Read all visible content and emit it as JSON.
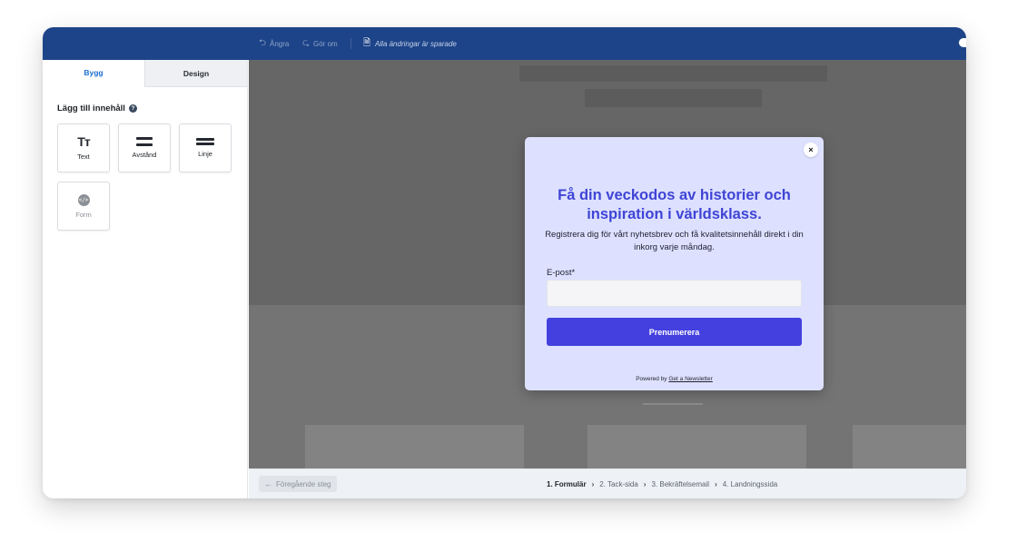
{
  "toolbar": {
    "undo_label": "Ångra",
    "undo_icon": "undo-arrow-icon",
    "redo_label": "Gör om",
    "redo_icon": "redo-arrow-icon",
    "saved_status": "Alla ändringar är sparade",
    "saved_icon": "document-check-icon",
    "preview_icon": "eye-icon"
  },
  "sidebar": {
    "tabs": [
      {
        "label": "Bygg",
        "active": true
      },
      {
        "label": "Design",
        "active": false
      }
    ],
    "section_title": "Lägg till innehåll",
    "help_icon": "?",
    "blocks": [
      {
        "label": "Text",
        "icon": "Tт"
      },
      {
        "label": "Avstånd",
        "icon": "spacer-icon"
      },
      {
        "label": "Linje",
        "icon": "divider-line-icon"
      },
      {
        "label": "Form",
        "icon": "</>"
      }
    ]
  },
  "popup": {
    "close_icon": "×",
    "heading": "Få din veckodos av historier och inspiration i världsklass.",
    "description": "Registrera dig för vårt nyhetsbrev och få kvalitetsinnehåll direkt i din inkorg varje måndag.",
    "email_label": "E-post*",
    "email_value": "",
    "email_placeholder": "",
    "submit_label": "Prenumerera",
    "powered_prefix": "Powered by",
    "powered_link": "Get a Newsletter",
    "accent_color": "#4340df",
    "background_color": "#dde1ff"
  },
  "footer": {
    "prev_label": "Föregående steg",
    "prev_icon": "←",
    "steps": [
      {
        "label": "1. Formulär",
        "active": true
      },
      {
        "label": "2. Tack-sida",
        "active": false
      },
      {
        "label": "3. Bekräftelsemail",
        "active": false
      },
      {
        "label": "4. Landningssida",
        "active": false
      }
    ],
    "separator": "›"
  },
  "colors": {
    "topbar": "#1d4488",
    "primary_link": "#1d6fd0"
  }
}
